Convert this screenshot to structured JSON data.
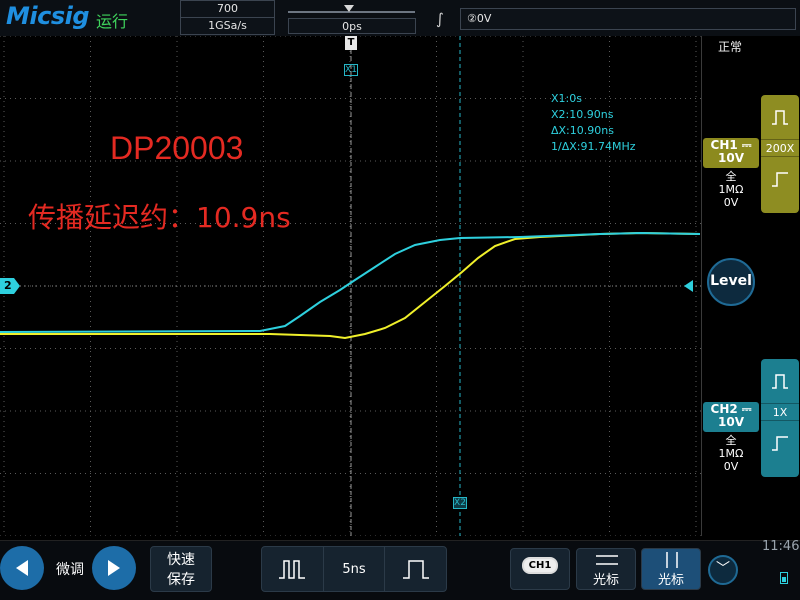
{
  "header": {
    "logo": "Micsig",
    "run_state": "运行",
    "sample_depth": "700",
    "sample_rate": "1GSa/s",
    "horizontal_position": "0ps",
    "trigger_edge_icon": "rising-edge-icon",
    "trigger_info": "②0V"
  },
  "status": {
    "mode": "正常"
  },
  "annotations": {
    "title": "DP20003",
    "delay": "传播延迟约：10.9ns"
  },
  "cursors": {
    "x1_marker": "T",
    "x1_label": "X1",
    "x2_label": "X2",
    "readout": [
      "X1:0s",
      "X2:10.90ns",
      "ΔX:10.90ns",
      "1/ΔX:91.74MHz"
    ]
  },
  "channel_marker": "2",
  "ch1": {
    "label": "CH1",
    "coupling_icon": "dc-coupling-icon",
    "scale": "10V",
    "bandwidth": "全",
    "impedance": "1MΩ",
    "offset": "0V",
    "probe": "200X",
    "color": "#f0f02a"
  },
  "ch2": {
    "label": "CH2",
    "coupling_icon": "dc-coupling-icon",
    "scale": "10V",
    "bandwidth": "全",
    "impedance": "1MΩ",
    "offset": "0V",
    "probe": "1X",
    "color": "#2ed0de"
  },
  "level_button": "Level",
  "bottom": {
    "fine_label": "微调",
    "save_label_line1": "快速",
    "save_label_line2": "保存",
    "timebase": "5ns",
    "ch_select": "CH1",
    "cursor_h_label": "光标",
    "cursor_v_label": "光标",
    "clock": "11:46"
  },
  "colors": {
    "accent": "#1d6da8",
    "annotation": "#e42a22",
    "ch1_trace": "#f0f02a",
    "ch2_trace": "#2ed0de"
  }
}
